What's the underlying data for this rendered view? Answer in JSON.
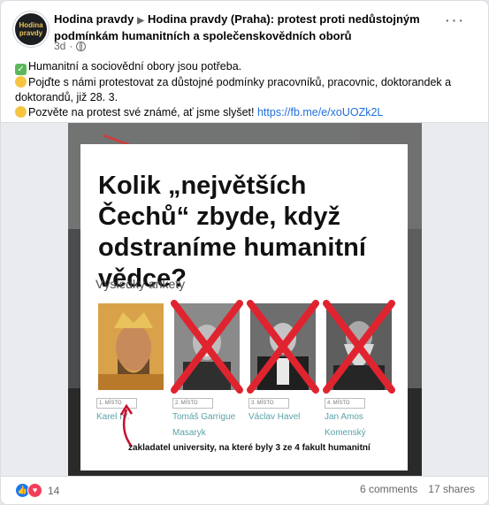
{
  "post": {
    "page_name": "Hodina pravdy",
    "avatar_text": "Hodina pravdy",
    "group_title": "Hodina pravdy (Praha): protest proti nedůstojným podmínkám humanitních a společenskovědních oborů",
    "time": "3d",
    "more": "···",
    "lines": [
      "Humanitní a sociovědní obory jsou potřeba.",
      "Pojďte s námi protestovat za důstojné podmínky pracovníků, pracovnic, doktorandek a doktorandů, již 28. 3.",
      "Pozvěte na protest své známé, ať jsme slyšet! "
    ],
    "link": "https://fb.me/e/xoUOZk2L"
  },
  "poster": {
    "headline": "Kolik „největších Čechů“ zbyde, když odstraníme humanitní vědce?",
    "subhead": "Výsledky ankety",
    "candidates": [
      {
        "rank": "1. MÍSTO",
        "name1": "Karel IV.",
        "name2": ""
      },
      {
        "rank": "2. MÍSTO",
        "name1": "Tomáš Garrigue",
        "name2": "Masaryk"
      },
      {
        "rank": "3. MÍSTO",
        "name1": "Václav Havel",
        "name2": ""
      },
      {
        "rank": "4. MÍSTO",
        "name1": "Jan Amos",
        "name2": "Komenský"
      }
    ],
    "annotation": "zakladatel university, na které byly 3 ze 4 fakult humanitní"
  },
  "footer": {
    "reaction_count": "14",
    "comments": "6 comments",
    "shares": "17 shares"
  },
  "colors": {
    "link": "#216fdb",
    "cross": "#e0242f",
    "name_teal": "#5aa2a8"
  }
}
